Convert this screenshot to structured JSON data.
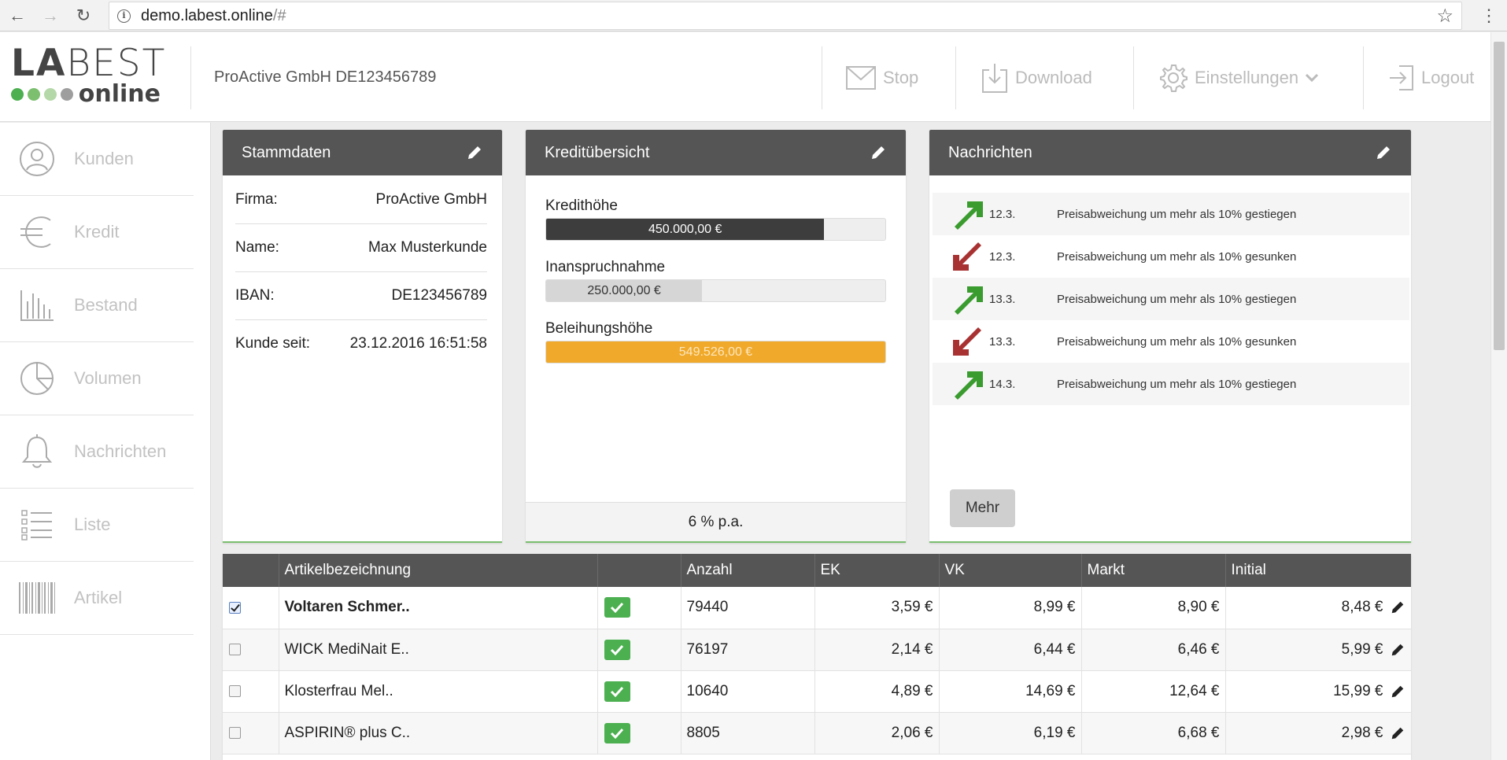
{
  "browser": {
    "url_host": "demo.labest.online",
    "url_path": "/#"
  },
  "logo": {
    "line1_bold": "LA",
    "line1_rest": "BEST",
    "line2": "online",
    "dot_colors": [
      "#4caf50",
      "#7cbf6f",
      "#b4d8a8",
      "#9e9e9e"
    ]
  },
  "header": {
    "company": "ProActive GmbH DE123456789",
    "stop_label": "Stop",
    "download_label": "Download",
    "settings_label": "Einstellungen",
    "logout_label": "Logout"
  },
  "sidebar": {
    "items": [
      {
        "label": "Kunden",
        "icon": "user-circle-icon"
      },
      {
        "label": "Kredit",
        "icon": "euro-icon"
      },
      {
        "label": "Bestand",
        "icon": "bar-chart-icon"
      },
      {
        "label": "Volumen",
        "icon": "pie-chart-icon"
      },
      {
        "label": "Nachrichten",
        "icon": "bell-icon"
      },
      {
        "label": "Liste",
        "icon": "list-icon"
      },
      {
        "label": "Artikel",
        "icon": "barcode-icon"
      }
    ]
  },
  "stammdaten": {
    "title": "Stammdaten",
    "rows": [
      {
        "label": "Firma:",
        "value": "ProActive GmbH"
      },
      {
        "label": "Name:",
        "value": "Max Musterkunde"
      },
      {
        "label": "IBAN:",
        "value": "DE123456789"
      },
      {
        "label": "Kunde seit:",
        "value": "23.12.2016 16:51:58"
      }
    ]
  },
  "kredit": {
    "title": "Kreditübersicht",
    "bars": [
      {
        "label": "Kredithöhe",
        "value_text": "450.000,00 €",
        "fraction": 0.82,
        "color": "#3d3d3d",
        "text_color": "#ffffff"
      },
      {
        "label": "Inanspruchnahme",
        "value_text": "250.000,00 €",
        "fraction": 0.46,
        "color": "#d6d6d6",
        "text_color": "#333333"
      },
      {
        "label": "Beleihungshöhe",
        "value_text": "549.526,00 €",
        "fraction": 1.0,
        "color": "#f0a92a",
        "text_color": "#fde7bf"
      }
    ],
    "rate": "6 % p.a."
  },
  "nachrichten": {
    "title": "Nachrichten",
    "items": [
      {
        "direction": "up",
        "date": "12.3.",
        "text": "Preisabweichung um mehr als 10% gestiegen"
      },
      {
        "direction": "down",
        "date": "12.3.",
        "text": "Preisabweichung um mehr als 10% gesunken"
      },
      {
        "direction": "up",
        "date": "13.3.",
        "text": "Preisabweichung um mehr als 10% gestiegen"
      },
      {
        "direction": "down",
        "date": "13.3.",
        "text": "Preisabweichung um mehr als 10% gesunken"
      },
      {
        "direction": "up",
        "date": "14.3.",
        "text": "Preisabweichung um mehr als 10% gestiegen"
      }
    ],
    "more_label": "Mehr",
    "up_color": "#3a9b2e",
    "down_color": "#a83232"
  },
  "table": {
    "headers": [
      "",
      "Artikelbezeichnung",
      "",
      "Anzahl",
      "EK",
      "VK",
      "Markt",
      "Initial"
    ],
    "rows": [
      {
        "checked": true,
        "name": "Voltaren Schmer..",
        "bold": true,
        "anzahl": "79440",
        "ek": "3,59 €",
        "vk": "8,99 €",
        "markt": "8,90 €",
        "initial": "8,48 €"
      },
      {
        "checked": false,
        "name": "WICK MediNait E..",
        "bold": false,
        "anzahl": "76197",
        "ek": "2,14 €",
        "vk": "6,44 €",
        "markt": "6,46 €",
        "initial": "5,99 €"
      },
      {
        "checked": false,
        "name": "Klosterfrau Mel..",
        "bold": false,
        "anzahl": "10640",
        "ek": "4,89 €",
        "vk": "14,69 €",
        "markt": "12,64 €",
        "initial": "15,99 €"
      },
      {
        "checked": false,
        "name": "ASPIRIN® plus C..",
        "bold": false,
        "anzahl": "8805",
        "ek": "2,06 €",
        "vk": "6,19 €",
        "markt": "6,68 €",
        "initial": "2,98 €"
      }
    ]
  }
}
